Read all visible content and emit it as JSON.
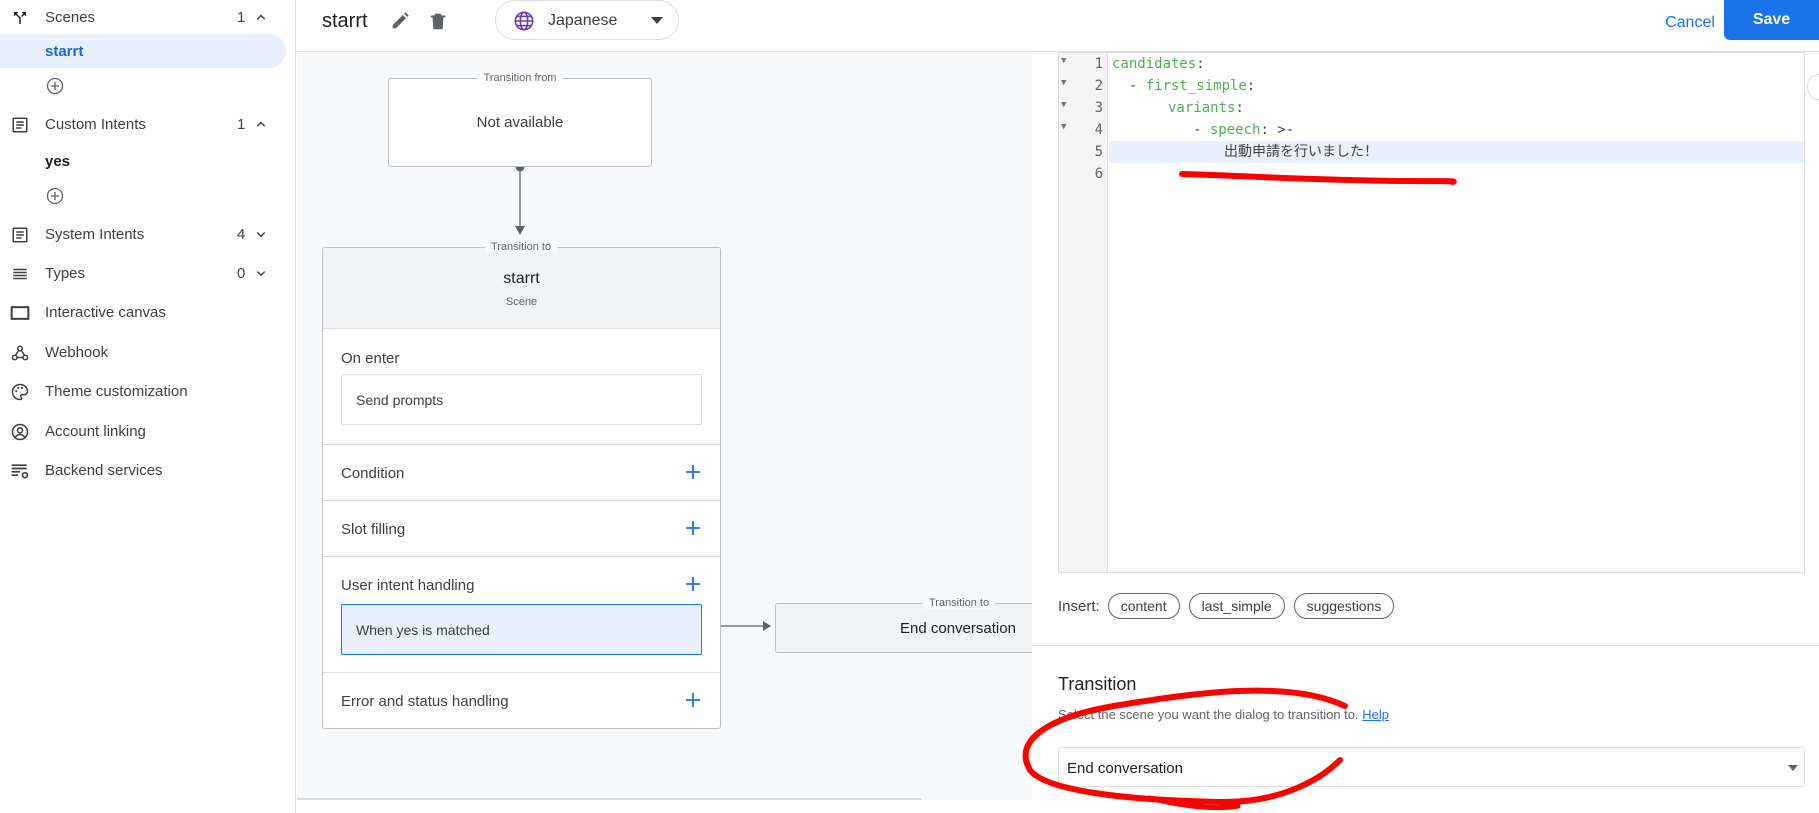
{
  "sidebar": {
    "scenes": {
      "label": "Scenes",
      "count": "1",
      "children": [
        "starrt"
      ]
    },
    "custom_intents": {
      "label": "Custom Intents",
      "count": "1",
      "children": [
        "yes"
      ]
    },
    "system_intents": {
      "label": "System Intents",
      "count": "4"
    },
    "types": {
      "label": "Types",
      "count": "0"
    },
    "interactive_canvas": {
      "label": "Interactive canvas"
    },
    "webhook": {
      "label": "Webhook"
    },
    "theme_customization": {
      "label": "Theme customization"
    },
    "account_linking": {
      "label": "Account linking"
    },
    "backend_services": {
      "label": "Backend services"
    }
  },
  "header": {
    "scene_title": "starrt",
    "language": "Japanese",
    "cancel_label": "Cancel",
    "save_label": "Save"
  },
  "canvas": {
    "transition_from": {
      "label": "Transition from",
      "value": "Not available"
    },
    "transition_to": {
      "label": "Transition to"
    },
    "scene": {
      "name": "starrt",
      "type": "Scene"
    },
    "sections": {
      "on_enter": {
        "title": "On enter",
        "item": "Send prompts"
      },
      "condition": {
        "title": "Condition"
      },
      "slot_filling": {
        "title": "Slot filling"
      },
      "user_intent_handling": {
        "title": "User intent handling",
        "item": "When yes is matched"
      },
      "error_status_handling": {
        "title": "Error and status handling"
      }
    },
    "end_node": {
      "label": "Transition to",
      "value": "End conversation"
    }
  },
  "editor": {
    "line_numbers": [
      "1",
      "2",
      "3",
      "4",
      "5",
      "6"
    ],
    "line1": {
      "key": "candidates",
      "colon": ":"
    },
    "line2": {
      "dash": "  - ",
      "key": "first_simple",
      "colon": ":"
    },
    "line3": {
      "key": "variants",
      "colon": ":"
    },
    "line4": {
      "dash": "- ",
      "key": "speech",
      "rest": ": >-"
    },
    "line5": {
      "text": "出動申請を行いました！"
    }
  },
  "insert": {
    "label": "Insert:",
    "chips": [
      "content",
      "last_simple",
      "suggestions"
    ]
  },
  "transition": {
    "title": "Transition",
    "help_text": "Select the scene you want the dialog to transition to.",
    "help_link": "Help",
    "selected": "End conversation"
  },
  "colors": {
    "primary": "#1a73e8",
    "selected_bg": "#e8f0fe",
    "annotation": "#ff0000",
    "yaml_key": "#4caf50"
  }
}
